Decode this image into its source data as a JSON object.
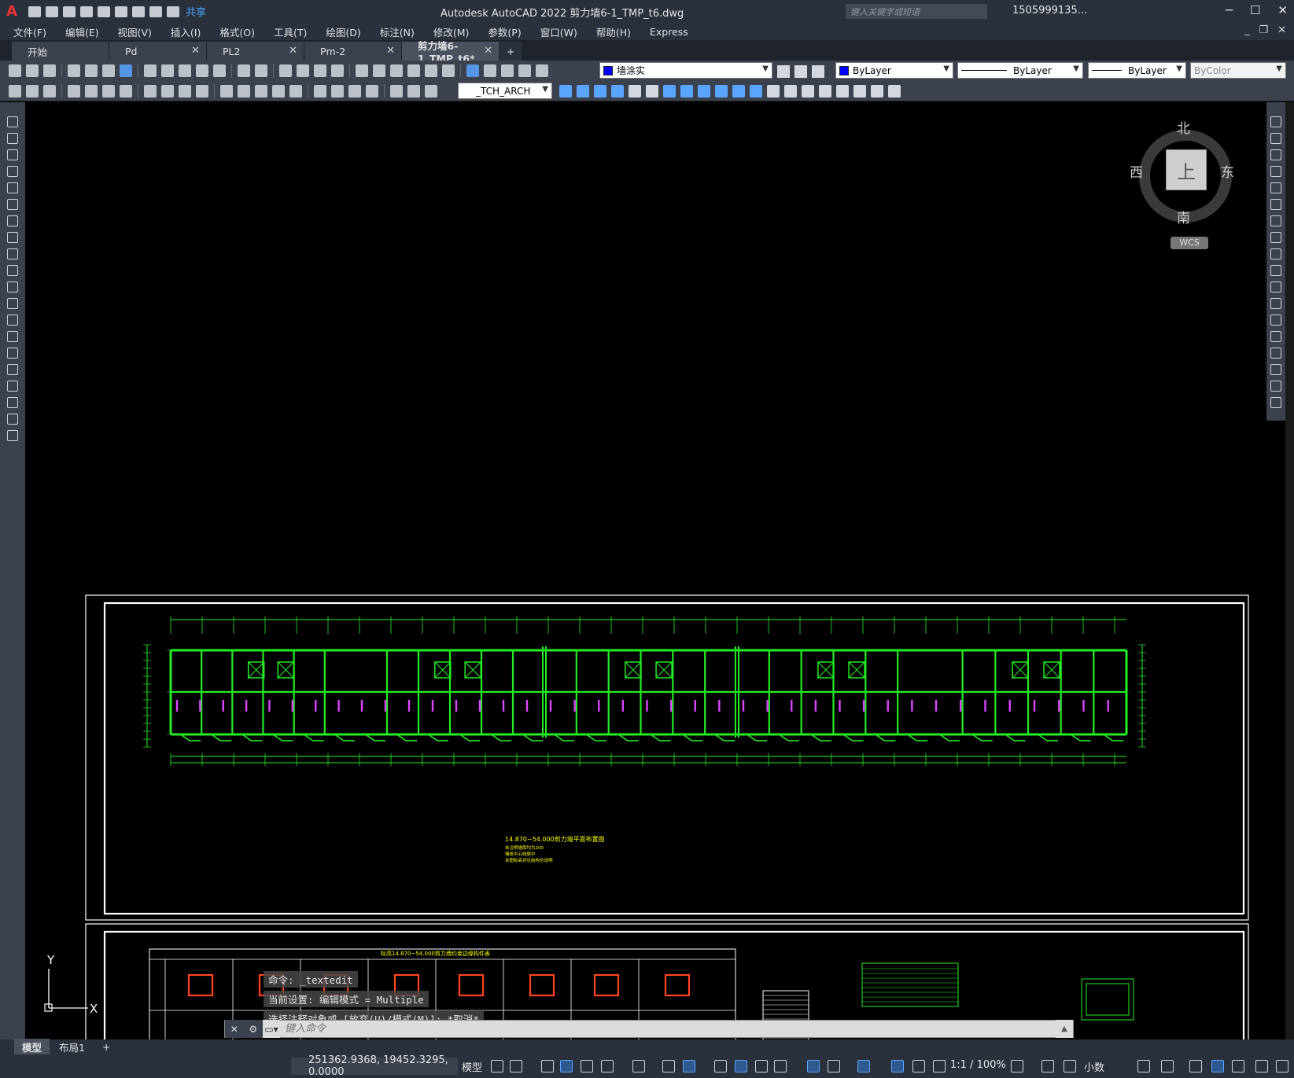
{
  "titlebar": {
    "logo": "A",
    "share_label": "共享",
    "title": "Autodesk AutoCAD 2022    剪力墙6-1_TMP_t6.dwg",
    "search_placeholder": "键入关键字或短语",
    "user": "1505999135...",
    "help": "?"
  },
  "menubar": {
    "items": [
      "文件(F)",
      "编辑(E)",
      "视图(V)",
      "插入(I)",
      "格式(O)",
      "工具(T)",
      "绘图(D)",
      "标注(N)",
      "修改(M)",
      "参数(P)",
      "窗口(W)",
      "帮助(H)",
      "Express"
    ]
  },
  "file_tabs": [
    {
      "label": "开始",
      "closable": false,
      "active": false
    },
    {
      "label": "Pd",
      "closable": true,
      "active": false
    },
    {
      "label": "PL2",
      "closable": true,
      "active": false
    },
    {
      "label": "Pm-2",
      "closable": true,
      "active": false
    },
    {
      "label": "剪力墙6-1_TMP_t6*",
      "closable": true,
      "active": true
    }
  ],
  "toolbar": {
    "layer_name": "墙涂实",
    "color": "ByLayer",
    "linetype": "ByLayer",
    "lineweight": "ByLayer",
    "plotstyle": "ByColor",
    "textstyle": "_TCH_ARCH"
  },
  "viewcube": {
    "north": "北",
    "south": "南",
    "east": "东",
    "west": "西",
    "face": "上",
    "wcs": "WCS"
  },
  "ucs": {
    "x": "X",
    "y": "Y"
  },
  "drawing": {
    "plan_title": "14.870~54.000剪力墙平面布置图",
    "plan_notes": [
      "未注明墙厚均为200",
      "墙体中心线居中",
      "本图标高详见结构总说明"
    ],
    "table_title": "标高14.870~54.000剪力墙约束边缘构件表"
  },
  "command_history": [
    "命令: _textedit",
    "当前设置: 编辑模式 = Multiple",
    "选择注释对象或 [放弃(U)/模式(M)]: *取消*"
  ],
  "command_placeholder": "键入命令",
  "layout_tabs": [
    "模型",
    "布局1"
  ],
  "status": {
    "coords": "251362.9368, 19452.3295, 0.0000",
    "space": "模型",
    "scale": "1:1 / 100%",
    "units": "小数"
  },
  "colors": {
    "accent": "#5aa5ff",
    "wall_green": "#22ee22",
    "dim_magenta": "#dd44ff",
    "text_yellow": "#ffff00"
  }
}
